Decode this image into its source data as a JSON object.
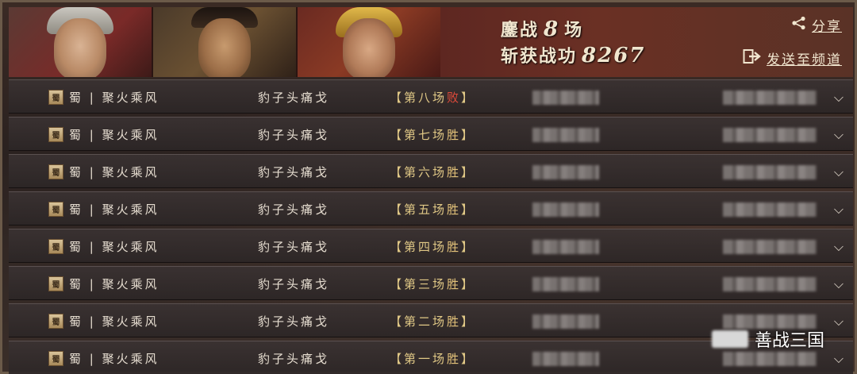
{
  "header": {
    "stats_line1_prefix": "鏖战",
    "battles_count": "8",
    "stats_line1_suffix": "场",
    "stats_line2_prefix": "斩获战功",
    "merit_points": "8267",
    "share_label": "分享",
    "send_label": "发送至频道"
  },
  "rows": [
    {
      "faction": "蜀",
      "team": "蜀 | 聚火乘风",
      "opponent": "豹子头痛戈",
      "match_open": "【 ",
      "match_label": "第八场",
      "result": "败",
      "match_close": " 】"
    },
    {
      "faction": "蜀",
      "team": "蜀 | 聚火乘风",
      "opponent": "豹子头痛戈",
      "match_open": "【 ",
      "match_label": "第七场",
      "result": "胜",
      "match_close": " 】"
    },
    {
      "faction": "蜀",
      "team": "蜀 | 聚火乘风",
      "opponent": "豹子头痛戈",
      "match_open": "【 ",
      "match_label": "第六场",
      "result": "胜",
      "match_close": " 】"
    },
    {
      "faction": "蜀",
      "team": "蜀 | 聚火乘风",
      "opponent": "豹子头痛戈",
      "match_open": "【 ",
      "match_label": "第五场",
      "result": "胜",
      "match_close": " 】"
    },
    {
      "faction": "蜀",
      "team": "蜀 | 聚火乘风",
      "opponent": "豹子头痛戈",
      "match_open": "【 ",
      "match_label": "第四场",
      "result": "胜",
      "match_close": " 】"
    },
    {
      "faction": "蜀",
      "team": "蜀 | 聚火乘风",
      "opponent": "豹子头痛戈",
      "match_open": "【 ",
      "match_label": "第三场",
      "result": "胜",
      "match_close": " 】"
    },
    {
      "faction": "蜀",
      "team": "蜀 | 聚火乘风",
      "opponent": "豹子头痛戈",
      "match_open": "【 ",
      "match_label": "第二场",
      "result": "胜",
      "match_close": " 】"
    },
    {
      "faction": "蜀",
      "team": "蜀 | 聚火乘风",
      "opponent": "豹子头痛戈",
      "match_open": "【 ",
      "match_label": "第一场",
      "result": "胜",
      "match_close": " 】"
    }
  ],
  "watermark": {
    "text": "善战三国"
  },
  "colors": {
    "win": "#e4c37a",
    "lose": "#e04a3a",
    "accent_gold": "#e0c886"
  },
  "icons": {
    "share": "share-nodes-icon",
    "send": "send-arrow-icon",
    "expand": "chevron-down-icon",
    "faction": "shu-banner-icon"
  }
}
